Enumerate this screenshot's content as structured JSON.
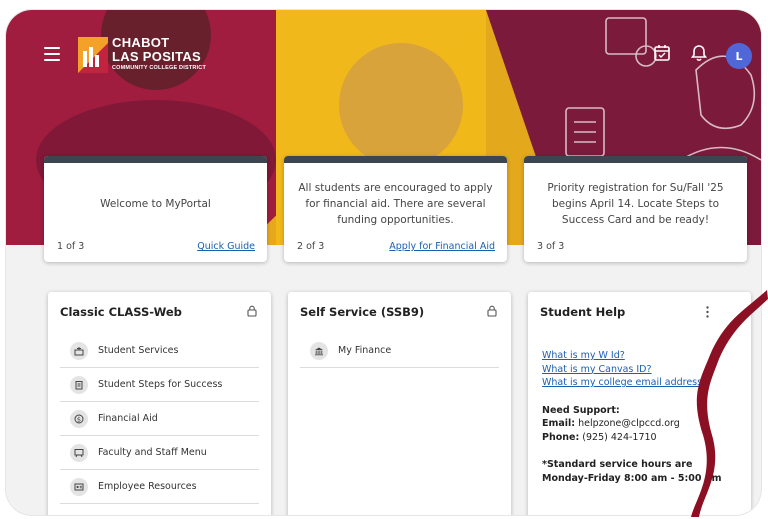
{
  "brand": {
    "line1": "CHABOT",
    "line2": "LAS POSITAS",
    "line3": "COMMUNITY COLLEGE DISTRICT"
  },
  "user": {
    "avatar_letter": "L"
  },
  "colors": {
    "maroon": "#a11d3f",
    "gold": "#f0b81a",
    "card_bar": "#3d4550",
    "link": "#1a5fb4",
    "avatar": "#4f67d9"
  },
  "announcements": [
    {
      "text": "Welcome to MyPortal",
      "counter": "1 of 3",
      "link": "Quick Guide"
    },
    {
      "text": "All students are encouraged to apply for financial aid. There are several funding opportunities.",
      "counter": "2 of 3",
      "link": "Apply for Financial Aid"
    },
    {
      "text": "Priority registration for Su/Fall '25 begins April 14. Locate Steps to Success Card and be ready!",
      "counter": "3 of 3",
      "link": ""
    }
  ],
  "classic": {
    "title": "Classic CLASS-Web",
    "items": [
      {
        "label": "Student Services",
        "icon": "student-services-icon"
      },
      {
        "label": "Student Steps for Success",
        "icon": "clipboard-icon"
      },
      {
        "label": "Financial Aid",
        "icon": "dollar-icon"
      },
      {
        "label": "Faculty and Staff Menu",
        "icon": "chalkboard-icon"
      },
      {
        "label": "Employee Resources",
        "icon": "id-card-icon"
      }
    ]
  },
  "ssb": {
    "title": "Self Service (SSB9)",
    "items": [
      {
        "label": "My Finance",
        "icon": "bank-icon"
      }
    ]
  },
  "help": {
    "title": "Student Help",
    "links": [
      "What is my W Id?",
      "What is my Canvas ID?",
      "What is my college email address?"
    ],
    "support_heading": "Need Support:",
    "email_label": "Email:",
    "email_value": "helpzone@clpccd.org",
    "phone_label": "Phone:",
    "phone_value": "(925) 424-1710",
    "hours_line1": "*Standard service hours are",
    "hours_line2": "Monday-Friday 8:00 am - 5:00 pm"
  }
}
